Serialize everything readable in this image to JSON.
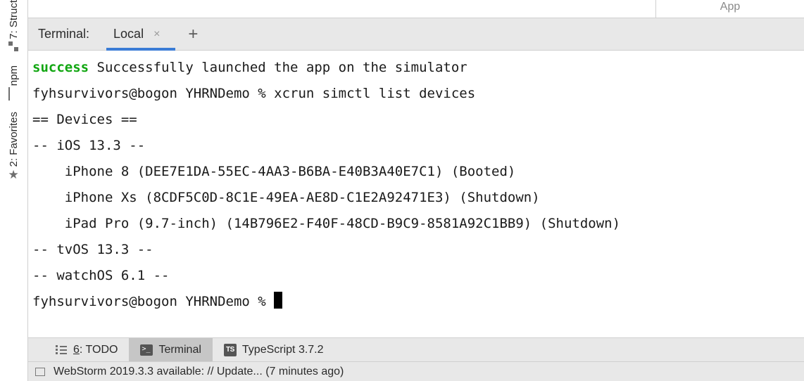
{
  "sidebar": {
    "items": [
      {
        "label": "7: Struct",
        "icon": "structure-icon"
      },
      {
        "label": "npm",
        "icon": "npm-icon"
      },
      {
        "label": "2: Favorites",
        "icon": "star-icon"
      }
    ]
  },
  "top": {
    "app_tab_label": "App"
  },
  "terminal": {
    "title": "Terminal:",
    "tab_label": "Local",
    "output": {
      "success_word": "success",
      "success_rest": " Successfully launched the app on the simulator",
      "line_cmd": "fyhsurvivors@bogon YHRNDemo % xcrun simctl list devices",
      "line_devices_hdr": "== Devices ==",
      "line_ios": "-- iOS 13.3 --",
      "line_iphone8": "    iPhone 8 (DEE7E1DA-55EC-4AA3-B6BA-E40B3A40E7C1) (Booted)",
      "line_iphonexs": "    iPhone Xs (8CDF5C0D-8C1E-49EA-AE8D-C1E2A92471E3) (Shutdown)",
      "line_ipad": "    iPad Pro (9.7-inch) (14B796E2-F40F-48CD-B9C9-8581A92C1BB9) (Shutdown)",
      "line_tvos": "-- tvOS 13.3 --",
      "line_watchos": "-- watchOS 6.1 --",
      "line_prompt": "fyhsurvivors@bogon YHRNDemo % "
    }
  },
  "bottom_tabs": {
    "todo_prefix": "6",
    "todo_rest": ": TODO",
    "terminal": "Terminal",
    "typescript": "TypeScript 3.7.2"
  },
  "statusbar": {
    "msg": "WebStorm 2019.3.3 available: // Update... (7 minutes ago)"
  }
}
